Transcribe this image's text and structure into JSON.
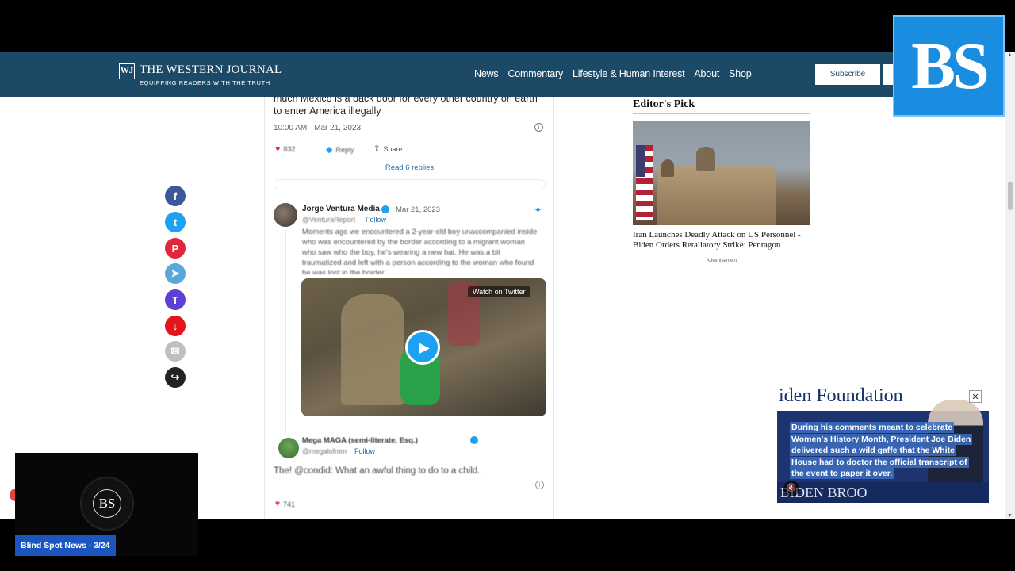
{
  "site": {
    "logo_mark": "WJ",
    "name": "THE WESTERN JOURNAL",
    "tagline": "EQUIPPING READERS WITH THE TRUTH",
    "nav": [
      "News",
      "Commentary",
      "Lifestyle & Human Interest",
      "About",
      "Shop"
    ],
    "subscribe_label": "Subscribe"
  },
  "share_icons": [
    {
      "name": "facebook-icon",
      "glyph": "f",
      "color": "#3b5998"
    },
    {
      "name": "twitter-icon",
      "glyph": "t",
      "color": "#1da1f2"
    },
    {
      "name": "parler-icon",
      "glyph": "P",
      "color": "#e0263b"
    },
    {
      "name": "telegram-icon",
      "glyph": "➤",
      "color": "#5aa7d9"
    },
    {
      "name": "truth-social-icon",
      "glyph": "T",
      "color": "#5d3fd3"
    },
    {
      "name": "gettr-icon",
      "glyph": "↓",
      "color": "#e3141c"
    },
    {
      "name": "email-icon",
      "glyph": "✉",
      "color": "#bfbfbf"
    },
    {
      "name": "share-icon",
      "glyph": "↪",
      "color": "#222222"
    }
  ],
  "tweet1": {
    "text": "much Mexico is a back door for every other country on earth to enter America illegally",
    "time": "10:00 AM · Mar 21, 2023",
    "likes": "832",
    "reply": "Reply",
    "share": "Share",
    "read_replies": "Read 6 replies"
  },
  "tweet2": {
    "author": "Jorge Ventura Media",
    "date": "Mar 21, 2023",
    "handle": "@VenturaReport",
    "follow": "Follow",
    "text": "Moments ago we encountered a 2-year-old boy unaccompanied inside who was encountered by the border according to a migrant woman who saw who the boy, he's wearing a new hat. He was a bit traumatized and left with a person according to the woman who found he was lost in the border.",
    "watch_label": "Watch on Twitter"
  },
  "tweet3": {
    "author": "Mega MAGA (semi-literate, Esq.)",
    "handle": "@megalofmm",
    "follow": "Follow",
    "text": "The! @condid: What an awful thing to do to a child.",
    "likes": "741"
  },
  "editors_pick": {
    "title": "Editor's Pick",
    "headline": "Iran Launches Deadly Attack on US Personnel - Biden Orders Retaliatory Strike: Pentagon",
    "ad_label": "Advertisement"
  },
  "video_ad": {
    "top_text": "iden Foundation",
    "caption": "During his comments meant to celebrate Women's History Month, President Joe Biden delivered such a wild gaffe that the White House had to doctor the official transcript of the event to paper it over.",
    "bottom_text": "BIDEN BROO"
  },
  "overlay": {
    "bs_logo": "BS",
    "player_logo": "BS",
    "player_label": "Blind Spot News - 3/24"
  }
}
